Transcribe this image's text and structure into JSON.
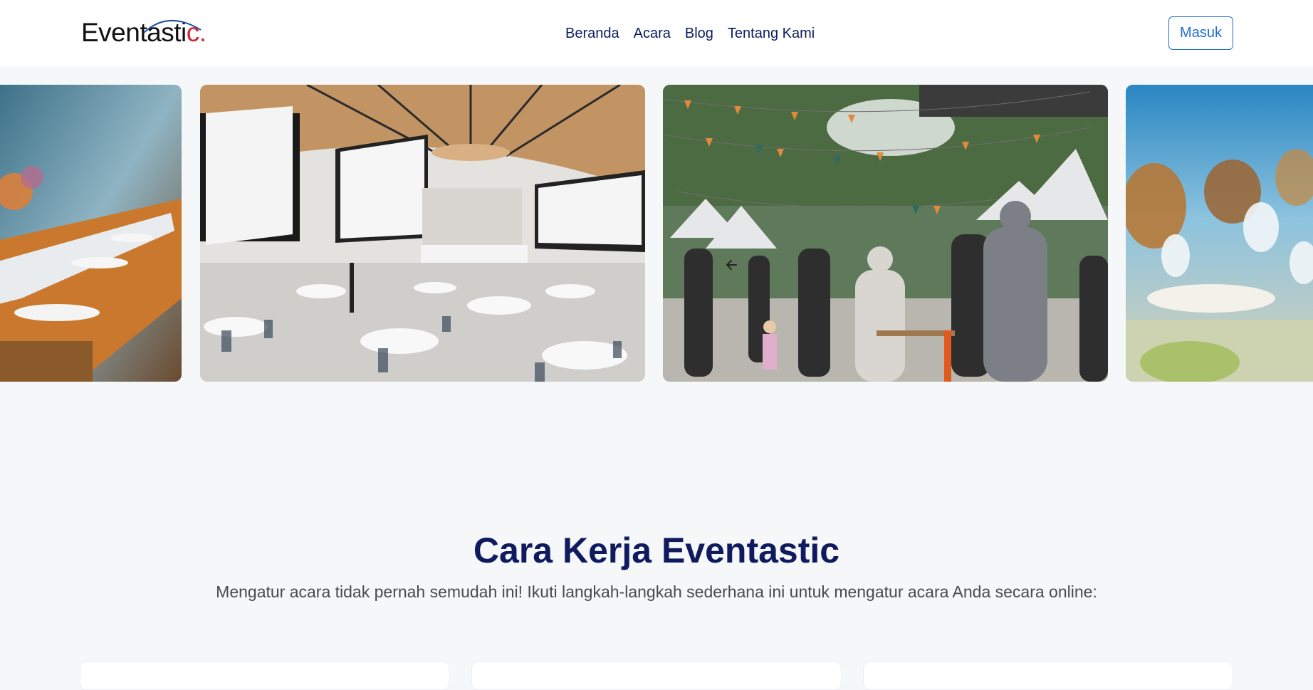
{
  "header": {
    "logo": {
      "main": "Eventasti",
      "accent": "c."
    },
    "nav": [
      "Beranda",
      "Acara",
      "Blog",
      "Tentang Kami"
    ],
    "login_label": "Masuk"
  },
  "carousel": {
    "slides": [
      "banquet-table-photo",
      "conference-hall-photo",
      "outdoor-market-festival-photo",
      "banquet-glasses-photo"
    ],
    "prev_icon": "arrow-left-icon"
  },
  "section": {
    "title": "Cara Kerja Eventastic",
    "subtitle": "Mengatur acara tidak pernah semudah ini! Ikuti langkah-langkah sederhana ini untuk mengatur acara Anda secara online:"
  },
  "colors": {
    "nav_text": "#0c1c5c",
    "accent_red": "#d3262e",
    "button_blue": "#1f6fd1",
    "page_bg": "#f6f7f9",
    "title": "#0f1b5e"
  }
}
